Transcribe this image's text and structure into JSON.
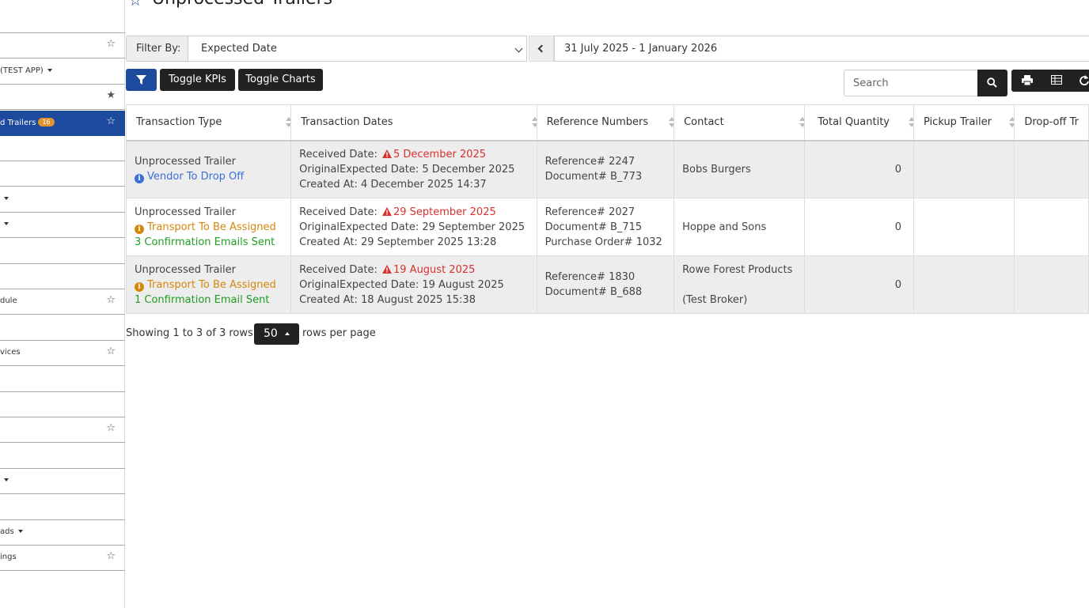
{
  "page": {
    "title": "Unprocessed Trailers"
  },
  "sidebar": {
    "items": [
      {
        "label": "",
        "star": "",
        "caret": false,
        "badge": "",
        "active": false
      },
      {
        "label": "",
        "star": "☆",
        "caret": false,
        "badge": "",
        "active": false
      },
      {
        "label": "(TEST APP)",
        "star": "",
        "caret": true,
        "badge": "",
        "active": false
      },
      {
        "label": "",
        "star": "★",
        "caret": false,
        "badge": "",
        "active": false
      },
      {
        "label": "d Trailers",
        "star": "☆",
        "caret": false,
        "badge": "16",
        "active": true
      },
      {
        "label": "",
        "star": "",
        "caret": false,
        "badge": "",
        "active": false
      },
      {
        "label": "",
        "star": "",
        "caret": false,
        "badge": "",
        "active": false
      },
      {
        "label": "",
        "star": "",
        "caret": true,
        "badge": "",
        "active": false
      },
      {
        "label": "",
        "star": "",
        "caret": true,
        "badge": "",
        "active": false
      },
      {
        "label": "",
        "star": "",
        "caret": false,
        "badge": "",
        "active": false
      },
      {
        "label": "",
        "star": "",
        "caret": false,
        "badge": "",
        "active": false
      },
      {
        "label": "dule",
        "star": "☆",
        "caret": false,
        "badge": "",
        "active": false
      },
      {
        "label": "",
        "star": "",
        "caret": false,
        "badge": "",
        "active": false
      },
      {
        "label": "vices",
        "star": "☆",
        "caret": false,
        "badge": "",
        "active": false
      },
      {
        "label": "",
        "star": "",
        "caret": false,
        "badge": "",
        "active": false
      },
      {
        "label": "",
        "star": "",
        "caret": false,
        "badge": "",
        "active": false
      },
      {
        "label": "",
        "star": "☆",
        "caret": false,
        "badge": "",
        "active": false
      },
      {
        "label": "",
        "star": "",
        "caret": false,
        "badge": "",
        "active": false
      },
      {
        "label": "",
        "star": "",
        "caret": true,
        "badge": "",
        "active": false
      },
      {
        "label": "",
        "star": "",
        "caret": false,
        "badge": "",
        "active": false
      },
      {
        "label": "ads",
        "star": "",
        "caret": true,
        "badge": "",
        "active": false
      },
      {
        "label": "ings",
        "star": "☆",
        "caret": false,
        "badge": "",
        "active": false
      }
    ]
  },
  "filter": {
    "label": "Filter By:",
    "selected": "Expected Date",
    "date_range": "31 July 2025 - 1 January 2026"
  },
  "toolbar": {
    "toggle_kpis": "Toggle KPIs",
    "toggle_charts": "Toggle Charts",
    "search_placeholder": "Search"
  },
  "table": {
    "columns": [
      "Transaction Type",
      "Transaction Dates",
      "Reference Numbers",
      "Contact",
      "Total Quantity",
      "Pickup Trailer",
      "Drop-off Tr"
    ],
    "rows": [
      {
        "type": "Unprocessed Trailer",
        "status": "Vendor To Drop Off",
        "status_color": "blue",
        "emails": "",
        "received_label": "Received Date:",
        "received": "5 December 2025",
        "expected": "OriginalExpected Date: 5 December 2025",
        "created": "Created At: 4 December 2025 14:37",
        "refs": [
          "Reference# 2247",
          "Document# B_773"
        ],
        "contact": "Bobs Burgers",
        "contact_sub": "",
        "quantity": "0"
      },
      {
        "type": "Unprocessed Trailer",
        "status": "Transport To Be Assigned",
        "status_color": "orange",
        "emails": "3 Confirmation Emails Sent",
        "received_label": "Received Date:",
        "received": "29 September 2025",
        "expected": "OriginalExpected Date: 29 September 2025",
        "created": "Created At: 29 September 2025 13:28",
        "refs": [
          "Reference# 2027",
          "Document# B_715",
          "Purchase Order# 1032"
        ],
        "contact": "Hoppe and Sons",
        "contact_sub": "",
        "quantity": "0"
      },
      {
        "type": "Unprocessed Trailer",
        "status": "Transport To Be Assigned",
        "status_color": "orange",
        "emails": "1 Confirmation Email Sent",
        "received_label": "Received Date:",
        "received": "19 August 2025",
        "expected": "OriginalExpected Date: 19 August 2025",
        "created": "Created At: 18 August 2025 15:38",
        "refs": [
          "Reference# 1830",
          "Document# B_688"
        ],
        "contact": "Rowe Forest Products",
        "contact_sub": "(Test Broker)",
        "quantity": "0"
      }
    ]
  },
  "pagination": {
    "showing": "Showing 1 to 3 of 3 rows",
    "page_size": "50",
    "rows_per_page": "rows per page"
  }
}
